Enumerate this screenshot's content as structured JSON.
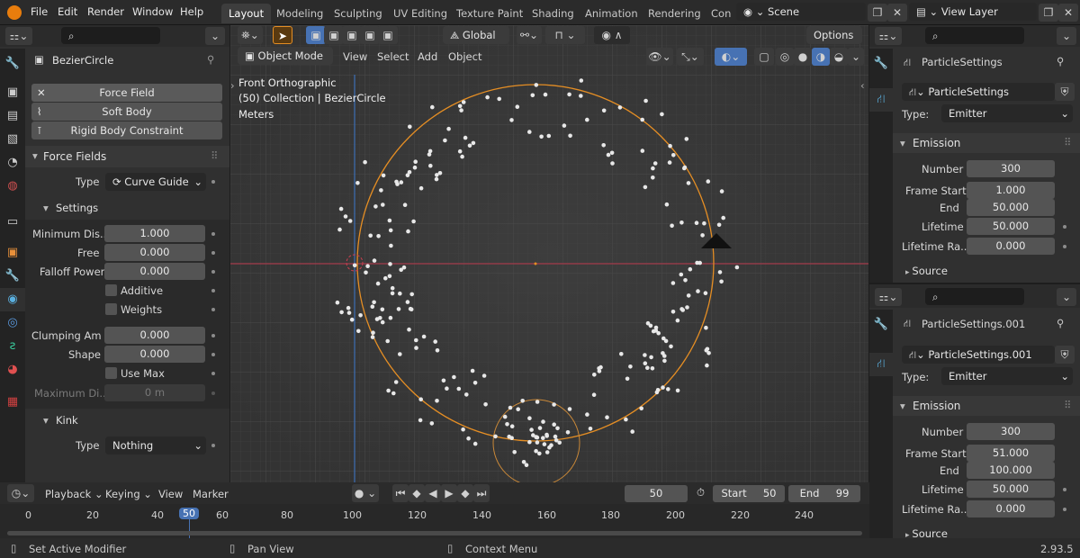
{
  "topbar": {
    "menus": [
      "File",
      "Edit",
      "Render",
      "Window",
      "Help"
    ],
    "workspaces": [
      "Layout",
      "Modeling",
      "Sculpting",
      "UV Editing",
      "Texture Paint",
      "Shading",
      "Animation",
      "Rendering",
      "Con"
    ],
    "scene": "Scene",
    "view_layer": "View Layer"
  },
  "left": {
    "object_name": "BezierCircle",
    "physics_buttons": [
      "Force Field",
      "Soft Body",
      "Rigid Body Constraint"
    ],
    "force_fields_title": "Force Fields",
    "type_label": "Type",
    "type_value": "Curve Guide",
    "settings_title": "Settings",
    "min_dist_label": "Minimum Dis...",
    "min_dist": "1.000",
    "free_label": "Free",
    "free": "0.000",
    "falloff_label": "Falloff Power",
    "falloff": "0.000",
    "additive_label": "Additive",
    "weights_label": "Weights",
    "clump_label": "Clumping Am",
    "clump": "0.000",
    "shape_label": "Shape",
    "shape": "0.000",
    "usemax_label": "Use Max",
    "maxdist_label": "Maximum Di...",
    "maxdist": "0 m",
    "kink_title": "Kink",
    "kink_type_label": "Type",
    "kink_type": "Nothing"
  },
  "viewport": {
    "mode": "Object Mode",
    "menus": [
      "View",
      "Select",
      "Add",
      "Object"
    ],
    "transform": "Global",
    "options": "Options",
    "info_line1": "Front Orthographic",
    "info_line2": "(50) Collection | BezierCircle",
    "info_line3": "Meters"
  },
  "rightA": {
    "name": "ParticleSettings",
    "datablock": "ParticleSettings",
    "type_label": "Type:",
    "type": "Emitter",
    "emission": "Emission",
    "number_label": "Number",
    "number": "300",
    "fstart_label": "Frame Start",
    "fstart": "1.000",
    "end_label": "End",
    "end": "50.000",
    "life_label": "Lifetime",
    "life": "50.000",
    "liferand_label": "Lifetime Ra...",
    "liferand": "0.000",
    "source": "Source"
  },
  "rightB": {
    "name": "ParticleSettings.001",
    "datablock": "ParticleSettings.001",
    "type_label": "Type:",
    "type": "Emitter",
    "emission": "Emission",
    "number_label": "Number",
    "number": "300",
    "fstart_label": "Frame Start",
    "fstart": "51.000",
    "end_label": "End",
    "end": "100.000",
    "life_label": "Lifetime",
    "life": "50.000",
    "liferand_label": "Lifetime Ra...",
    "liferand": "0.000",
    "source": "Source"
  },
  "timeline": {
    "menus": [
      "Playback",
      "Keying",
      "View",
      "Marker"
    ],
    "current_frame": "50",
    "start_label": "Start",
    "start": "50",
    "end_label": "End",
    "end": "99",
    "ticks": [
      "0",
      "20",
      "40",
      "50",
      "60",
      "80",
      "100",
      "120",
      "140",
      "160",
      "180",
      "200",
      "220",
      "240"
    ]
  },
  "status": {
    "left": "Set Active Modifier",
    "mid": "Pan View",
    "right": "Context Menu",
    "version": "2.93.5"
  }
}
